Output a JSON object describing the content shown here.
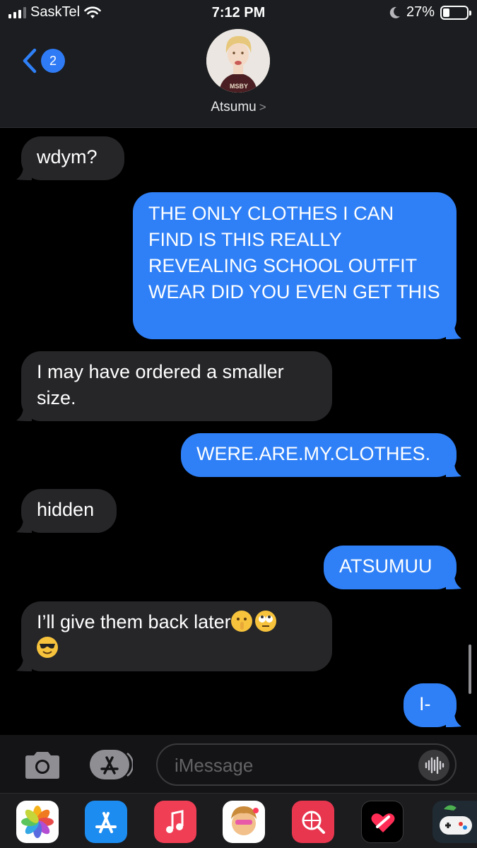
{
  "status_bar": {
    "carrier": "SaskTel",
    "time": "7:12 PM",
    "battery": "27%",
    "battery_level": 0.27,
    "signal_bars": 3
  },
  "header": {
    "back_badge": "2",
    "contact_name": "Atsumu",
    "contact_chevron": ">"
  },
  "messages": [
    {
      "from": "them",
      "text": "wdym?"
    },
    {
      "from": "me",
      "text": "THE ONLY CLOTHES I CAN FIND IS THIS REALLY REVEALING SCHOOL OUTFIT WEAR DID YOU EVEN GET THIS"
    },
    {
      "from": "them",
      "text": "I may have ordered a smaller size."
    },
    {
      "from": "me",
      "text": "WERE.ARE.MY.CLOTHES."
    },
    {
      "from": "them",
      "text": "hidden"
    },
    {
      "from": "me",
      "text": "ATSUMUU"
    },
    {
      "from": "them",
      "text": "I’ll give them back later",
      "emoji": [
        "shushing-face",
        "face-with-rolling-eyes",
        "smiling-face-with-sunglasses"
      ]
    },
    {
      "from": "me",
      "text": "I-"
    }
  ],
  "input": {
    "placeholder": "iMessage",
    "camera_icon": "camera-icon",
    "apps_icon": "app-store-icon",
    "audio_icon": "waveform-icon"
  },
  "app_drawer": [
    "photos-icon",
    "app-store-icon",
    "music-icon",
    "memoji-icon",
    "web-search-icon",
    "digital-touch-icon",
    "game-controller-icon"
  ],
  "colors": {
    "outgoing_bubble": "#2f80f7",
    "incoming_bubble": "#262629",
    "background": "#000000",
    "header": "#1b1d20"
  }
}
